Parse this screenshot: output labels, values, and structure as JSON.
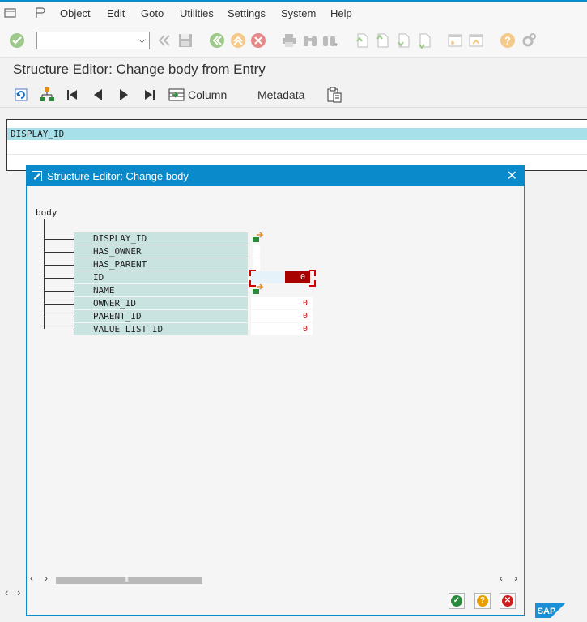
{
  "menu": {
    "items": [
      {
        "label": "Object"
      },
      {
        "label": "Edit"
      },
      {
        "label": "Goto"
      },
      {
        "label": "Utilities"
      },
      {
        "label": "Settings"
      },
      {
        "label": "System"
      },
      {
        "label": "Help"
      }
    ]
  },
  "toolbar": {
    "command_field_value": ""
  },
  "screen": {
    "title": "Structure Editor: Change body from Entry"
  },
  "app_toolbar": {
    "column_label": "Column",
    "metadata_label": "Metadata"
  },
  "grid": {
    "selected_row": "DISPLAY_ID"
  },
  "dialog": {
    "title": "Structure Editor: Change body",
    "close_glyph": "✕",
    "tree_root": "body",
    "fields": [
      {
        "name": "DISPLAY_ID",
        "value": ""
      },
      {
        "name": "HAS_OWNER",
        "value": ""
      },
      {
        "name": "HAS_PARENT",
        "value": ""
      },
      {
        "name": "ID",
        "value": "0"
      },
      {
        "name": "NAME",
        "value": ""
      },
      {
        "name": "OWNER_ID",
        "value": "0"
      },
      {
        "name": "PARENT_ID",
        "value": "0"
      },
      {
        "name": "VALUE_LIST_ID",
        "value": "0"
      }
    ]
  },
  "colors": {
    "accent": "#0a8acb",
    "field_label_bg": "#c9e3e0",
    "value_red": "#c00000",
    "grid_highlight": "#a8e0ea"
  },
  "icons": [
    "enter-icon",
    "save-icon",
    "back-icon",
    "exit-icon",
    "cancel-icon",
    "print-icon",
    "find-icon",
    "find-next-icon",
    "first-page-icon",
    "previous-page-icon",
    "next-page-icon",
    "last-page-icon",
    "create-session-icon",
    "shortcut-icon",
    "help-icon",
    "customize-icon",
    "refresh-icon",
    "hierarchy-icon",
    "first-icon",
    "previous-icon",
    "next-icon",
    "last-icon",
    "column-icon",
    "clipboard-icon",
    "edit-pencil-icon",
    "continue-icon",
    "help-button-icon",
    "cancel-button-icon",
    "sap-logo"
  ]
}
